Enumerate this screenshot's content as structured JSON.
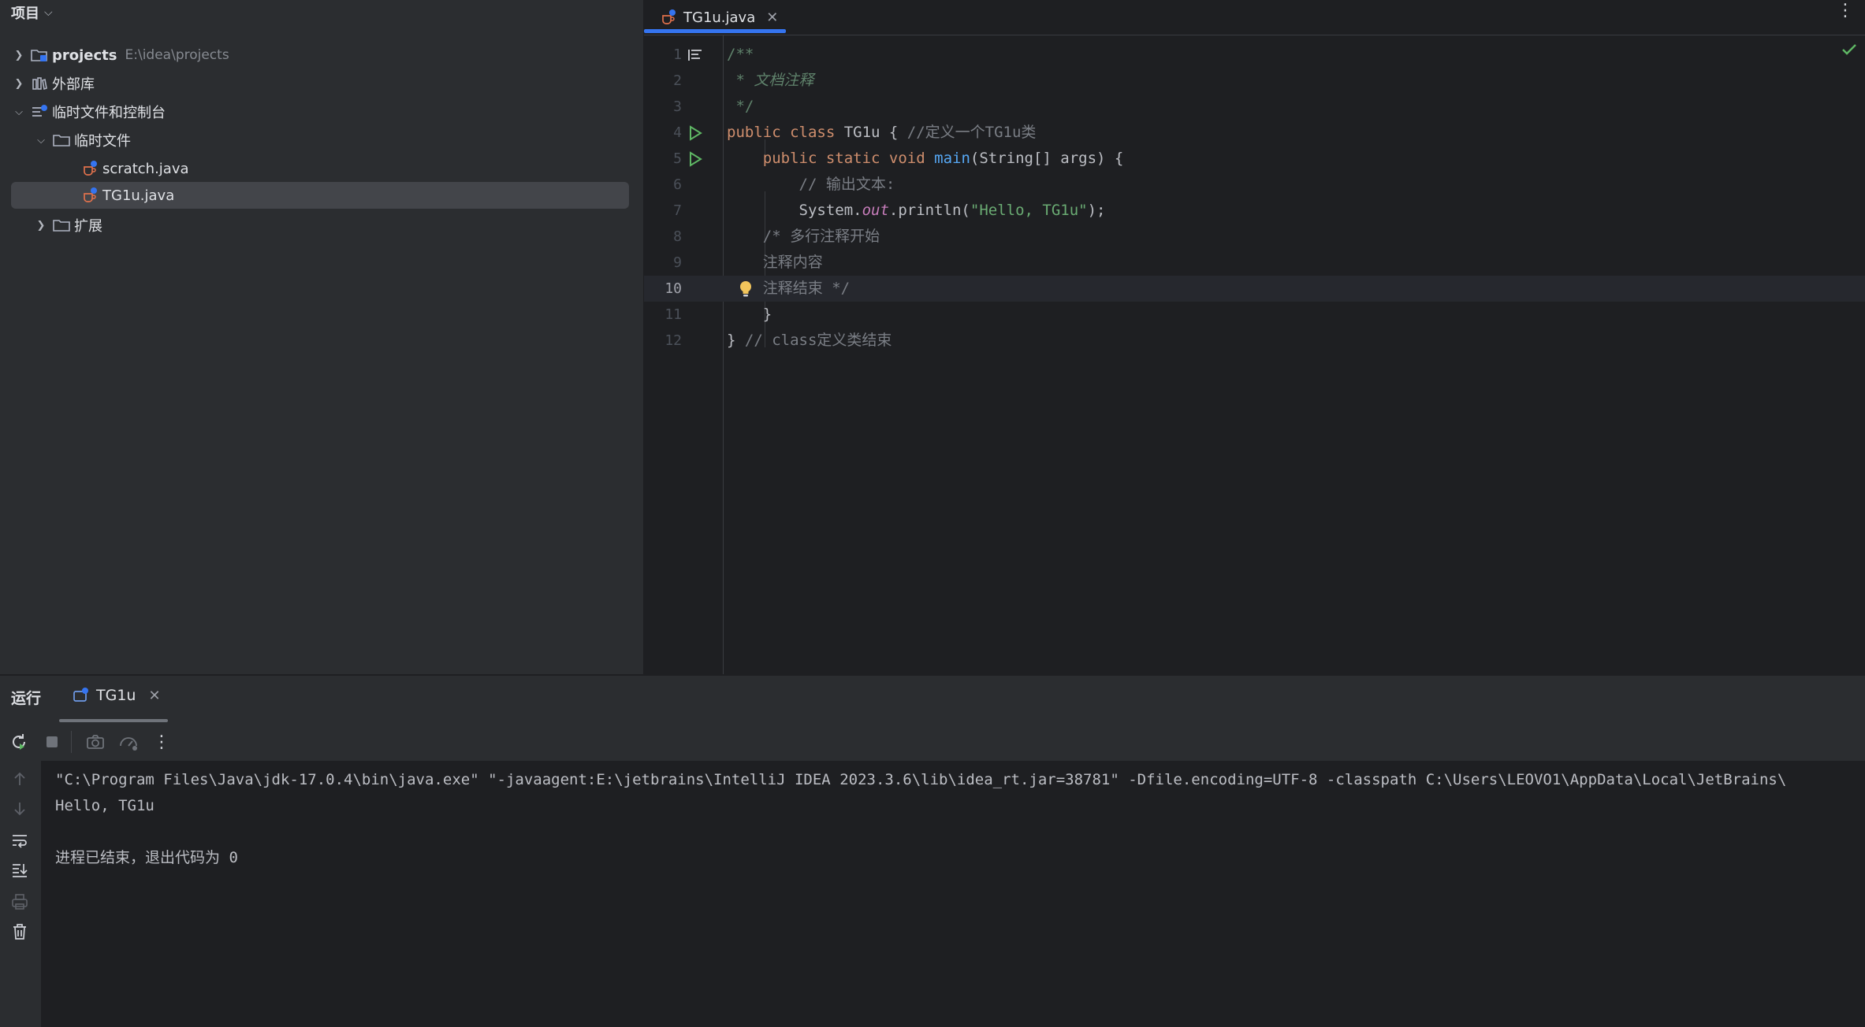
{
  "project_panel": {
    "title": "项目",
    "tree": [
      {
        "label": "projects",
        "hint": "E:\\idea\\projects",
        "icon": "module-folder-icon",
        "expanded": false
      },
      {
        "label": "外部库",
        "icon": "library-icon",
        "expanded": false
      },
      {
        "label": "临时文件和控制台",
        "icon": "scratches-icon",
        "expanded": true
      },
      {
        "label": "临时文件",
        "icon": "folder-icon",
        "expanded": true
      },
      {
        "label": "scratch.java",
        "icon": "java-file-icon"
      },
      {
        "label": "TG1u.java",
        "icon": "java-file-icon",
        "selected": true
      },
      {
        "label": "扩展",
        "icon": "folder-icon",
        "expanded": false
      }
    ]
  },
  "editor": {
    "active_tab": "TG1u.java",
    "current_line": 10,
    "line_numbers": [
      "1",
      "2",
      "3",
      "4",
      "5",
      "6",
      "7",
      "8",
      "9",
      "10",
      "11",
      "12"
    ]
  },
  "code": {
    "l1": "/**",
    "l2_star": " * ",
    "l2_text": "文档注释",
    "l3": " */",
    "l4_kw": "public class",
    "l4_name": " TG1u { ",
    "l4_comment": "//定义一个TG1u类",
    "l5_indent": "    ",
    "l5_kw": "public static void",
    "l5_sp": " ",
    "l5_fn": "main",
    "l5_rest": "(String[] args) {",
    "l6": "        // 输出文本:",
    "l7_a": "        System.",
    "l7_field": "out",
    "l7_b": ".println(",
    "l7_str": "\"Hello, TG1u\"",
    "l7_c": ");",
    "l8": "    /* 多行注释开始",
    "l9": "    注释内容",
    "l10": "    注释结束 */",
    "l11": "    }",
    "l12_a": "} ",
    "l12_comment": "// class定义类结束"
  },
  "run_panel": {
    "title": "运行",
    "tab": "TG1u",
    "console": [
      "\"C:\\Program Files\\Java\\jdk-17.0.4\\bin\\java.exe\" \"-javaagent:E:\\jetbrains\\IntelliJ IDEA 2023.3.6\\lib\\idea_rt.jar=38781\" -Dfile.encoding=UTF-8 -classpath C:\\Users\\LEOVO1\\AppData\\Local\\JetBrains\\",
      "Hello, TG1u",
      "",
      "进程已结束，退出代码为 0"
    ]
  },
  "colors": {
    "accent": "#3574f0",
    "run_green": "#5fb865",
    "bulb_yellow": "#f2c55c",
    "panel_bg": "#2b2d30",
    "editor_bg": "#1e1f22"
  }
}
